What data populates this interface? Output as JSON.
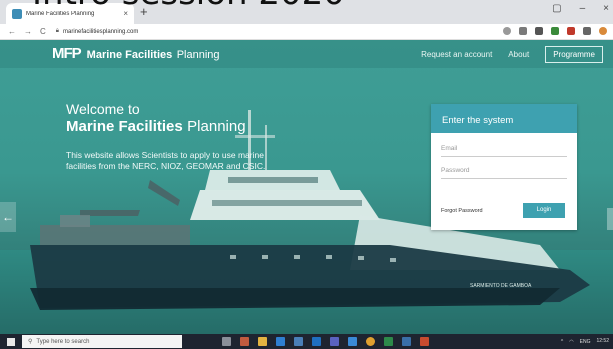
{
  "caption": {
    "text": "Intro session 2020"
  },
  "browser": {
    "tab_title": "Marine Facilities Planning",
    "tab_close": "×",
    "new_tab": "+",
    "url": "marinefacilitiesplanning.com",
    "nav": {
      "back": "←",
      "forward": "→",
      "reload": "C"
    },
    "window": {
      "minimize": "–",
      "close": "×"
    }
  },
  "site": {
    "logo_mark": "MFP",
    "logo_bold": "Marine Facilities",
    "logo_light": "Planning",
    "nav": {
      "request": "Request an account",
      "about": "About",
      "programme": "Programme"
    },
    "welcome_line": "Welcome to",
    "welcome_bold": "Marine Facilities",
    "welcome_light": "Planning",
    "intro": "This website allows Scientists to apply to use marine facilities from the NERC, NIOZ, GEOMAR and CSIC.",
    "ship_name": "SARMIENTO DE GAMBOA",
    "carousel_prev": "←"
  },
  "login": {
    "title": "Enter the system",
    "email_placeholder": "Email",
    "password_placeholder": "Password",
    "forgot": "Forgot Password",
    "button": "Login"
  },
  "taskbar": {
    "search_placeholder": "Type here to search",
    "language": "ENG",
    "time": "12:52"
  },
  "colors": {
    "accent": "#3ea1b0",
    "hero": "#3a9890",
    "taskbar": "#1e2430"
  }
}
